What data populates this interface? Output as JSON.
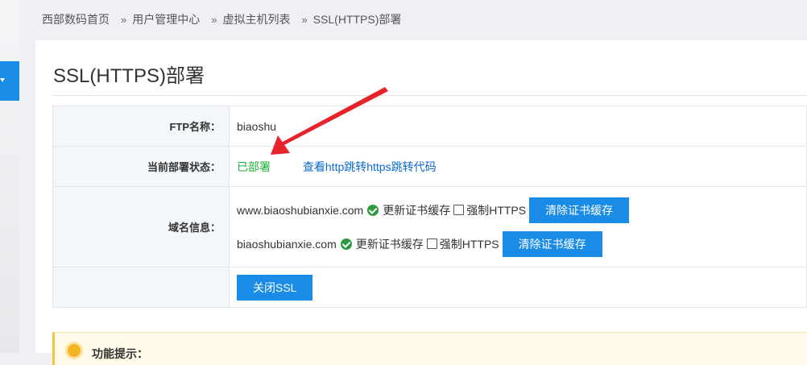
{
  "breadcrumb": {
    "items": [
      "西部数码首页",
      "用户管理中心",
      "虚拟主机列表",
      "SSL(HTTPS)部署"
    ],
    "separator": "»"
  },
  "page": {
    "title": "SSL(HTTPS)部署"
  },
  "form": {
    "ftp": {
      "label": "FTP名称：",
      "value": "biaoshu"
    },
    "status": {
      "label": "当前部署状态：",
      "value": "已部署",
      "link": "查看http跳转https跳转代码"
    },
    "domains": {
      "label": "域名信息：",
      "items": [
        {
          "name": "www.biaoshubianxie.com",
          "refresh": "更新证书缓存",
          "force": "强制HTTPS",
          "clear": "清除证书缓存"
        },
        {
          "name": "biaoshubianxie.com",
          "refresh": "更新证书缓存",
          "force": "强制HTTPS",
          "clear": "清除证书缓存"
        }
      ]
    },
    "close_button": "关闭SSL"
  },
  "tip": {
    "title": "功能提示："
  },
  "colors": {
    "accent": "#1a8ce8",
    "success": "#1bb33a",
    "link": "#0a6bd1",
    "annotation_arrow": "#e8232b"
  },
  "icons": {
    "status_ok": "check-circle-icon",
    "side_menu": "chevron-down-icon",
    "tip": "lightbulb-icon"
  }
}
